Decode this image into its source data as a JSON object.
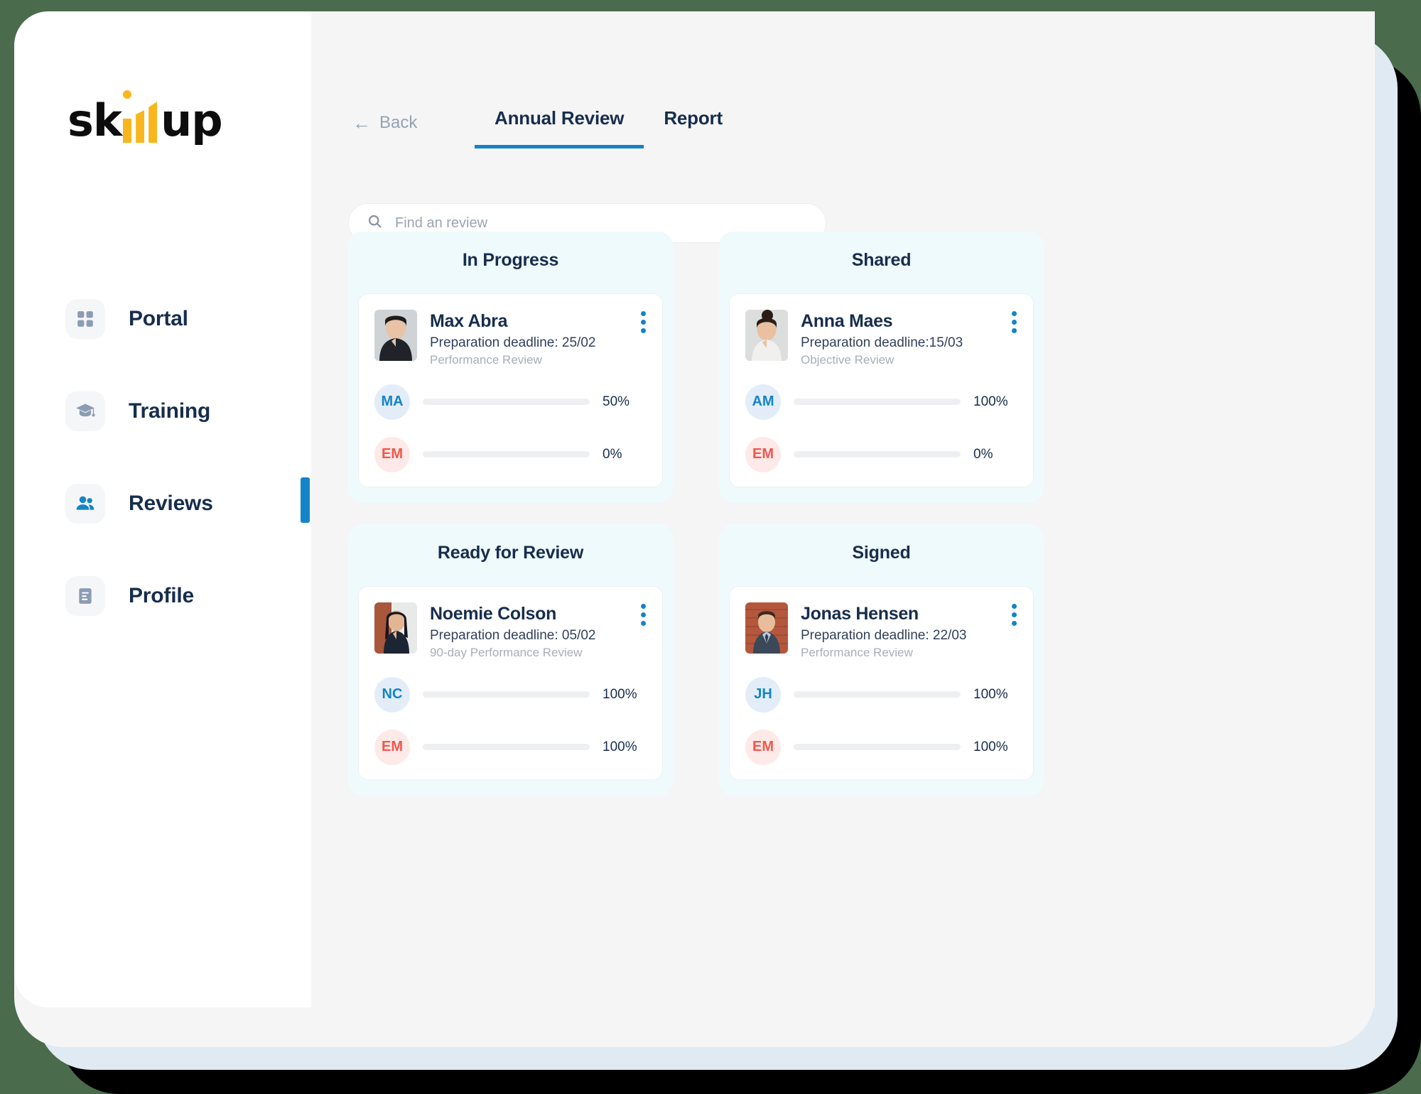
{
  "brand": {
    "logo_text_start": "sk",
    "logo_text_end": "up",
    "logo_name": "skillup"
  },
  "sidebar": {
    "items": [
      {
        "label": "Portal",
        "icon": "grid-icon",
        "active": false
      },
      {
        "label": "Training",
        "icon": "graduation-cap-icon",
        "active": false
      },
      {
        "label": "Reviews",
        "icon": "people-icon",
        "active": true
      },
      {
        "label": "Profile",
        "icon": "document-icon",
        "active": false
      }
    ]
  },
  "topbar": {
    "back_label": "Back",
    "back_arrow": "←",
    "tabs": [
      {
        "label": "Annual Review",
        "active": true
      },
      {
        "label": "Report",
        "active": false
      }
    ]
  },
  "search": {
    "placeholder": "Find an review",
    "value": "",
    "icon": "search-icon"
  },
  "colors": {
    "accent_blue": "#1484c8",
    "amber": "#fabc10",
    "green": "#1bb07f",
    "navy_text": "#172d4d",
    "column_bg": "#effafc",
    "muted_text": "#a7aeb9"
  },
  "board": {
    "columns": [
      {
        "title": "In Progress",
        "cards": [
          {
            "name": "Max Abra",
            "deadline": "Preparation deadline: 25/02",
            "type": "Performance Review",
            "avatar_alt": "Max Abra photo",
            "progress": [
              {
                "initials": "MA",
                "initials_style": "blue",
                "percent": 50,
                "percent_label": "50%",
                "bar_color": "amber"
              },
              {
                "initials": "EM",
                "initials_style": "red",
                "percent": 0,
                "percent_label": "0%",
                "bar_color": "amber"
              }
            ]
          }
        ]
      },
      {
        "title": "Shared",
        "cards": [
          {
            "name": "Anna Maes",
            "deadline": "Preparation deadline:15/03",
            "type": "Objective Review",
            "avatar_alt": "Anna Maes photo",
            "progress": [
              {
                "initials": "AM",
                "initials_style": "blue",
                "percent": 100,
                "percent_label": "100%",
                "bar_color": "amber"
              },
              {
                "initials": "EM",
                "initials_style": "red",
                "percent": 0,
                "percent_label": "0%",
                "bar_color": "amber"
              }
            ]
          }
        ]
      },
      {
        "title": "Ready for Review",
        "cards": [
          {
            "name": "Noemie Colson",
            "deadline": "Preparation deadline: 05/02",
            "type": "90-day Performance Review",
            "avatar_alt": "Noemie Colson photo",
            "progress": [
              {
                "initials": "NC",
                "initials_style": "blue",
                "percent": 100,
                "percent_label": "100%",
                "bar_color": "amber"
              },
              {
                "initials": "EM",
                "initials_style": "red",
                "percent": 100,
                "percent_label": "100%",
                "bar_color": "amber"
              }
            ]
          }
        ]
      },
      {
        "title": "Signed",
        "cards": [
          {
            "name": "Jonas Hensen",
            "deadline": "Preparation deadline: 22/03",
            "type": "Performance Review",
            "avatar_alt": "Jonas Hensen photo",
            "progress": [
              {
                "initials": "JH",
                "initials_style": "blue",
                "percent": 100,
                "percent_label": "100%",
                "bar_color": "green"
              },
              {
                "initials": "EM",
                "initials_style": "red",
                "percent": 100,
                "percent_label": "100%",
                "bar_color": "green"
              }
            ]
          }
        ]
      }
    ]
  }
}
